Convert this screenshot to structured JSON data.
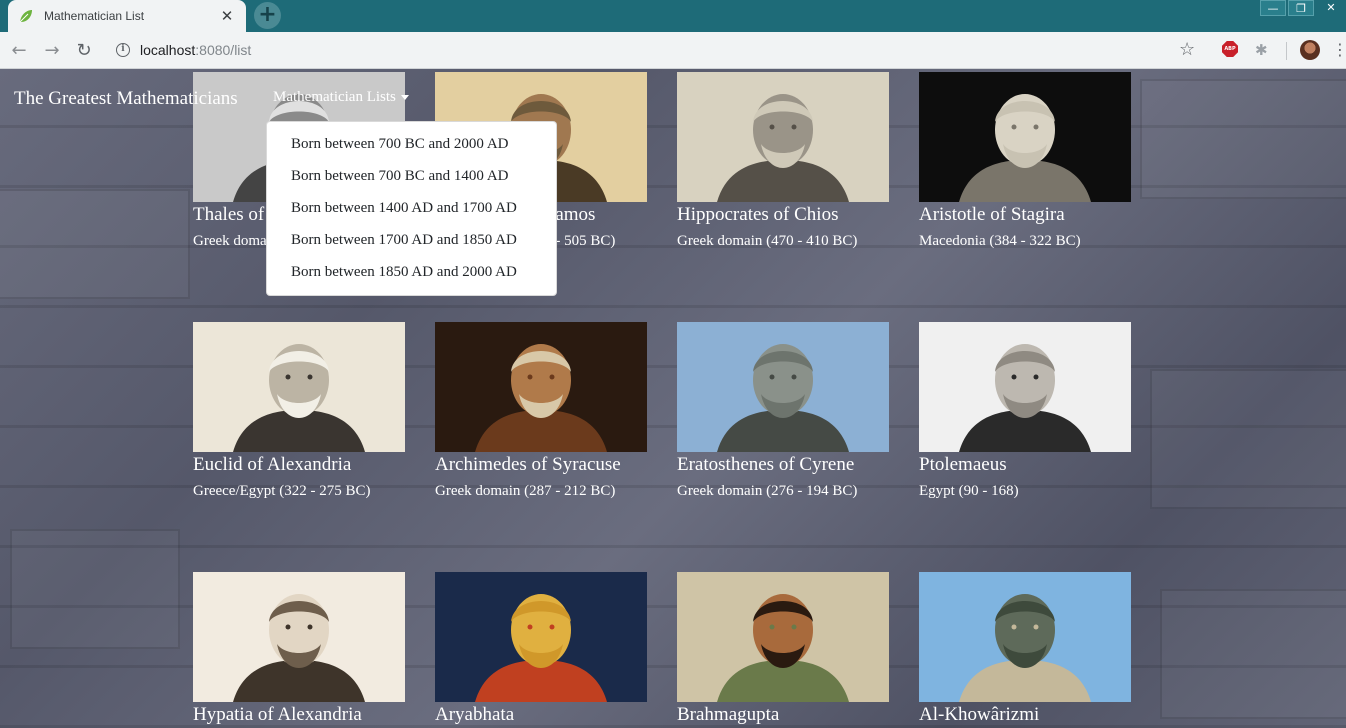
{
  "browser": {
    "tab_title": "Mathematician List",
    "tab_close": "✕",
    "new_tab": "+",
    "url_host": "localhost",
    "url_rest": ":8080/list",
    "nav": {
      "back": "←",
      "forward": "→",
      "reload": "↻"
    },
    "window_controls": {
      "minimize": "—",
      "maximize": "❐",
      "close": "✕"
    },
    "star": "☆",
    "abp": "ABP",
    "ext": "✱",
    "menu": "⋮",
    "info": "i"
  },
  "navbar": {
    "brand": "The Greatest Mathematicians",
    "dropdown_label": "Mathematician Lists"
  },
  "dropdown": {
    "items": [
      "Born between 700 BC and 2000 AD",
      "Born between 700 BC and 1400 AD",
      "Born between 1400 AD and 1700 AD",
      "Born between 1700 AD and 1850 AD",
      "Born between 1850 AD and 2000 AD"
    ]
  },
  "cards": [
    {
      "name": "Thales of Miletus",
      "info": "Greek domain (624 - 546 BC)",
      "palette": "bw"
    },
    {
      "name": "Pythagoras of Samos",
      "info": "Greek domain (570 - 505 BC)",
      "palette": "parchment"
    },
    {
      "name": "Hippocrates of Chios",
      "info": "Greek domain (470 - 410 BC)",
      "palette": "sepia"
    },
    {
      "name": "Aristotle of Stagira",
      "info": "Macedonia (384 - 322 BC)",
      "palette": "marble"
    },
    {
      "name": "Euclid of Alexandria",
      "info": "Greece/Egypt (322 - 275 BC)",
      "palette": "engraving"
    },
    {
      "name": "Archimedes of Syracuse",
      "info": "Greek domain (287 - 212 BC)",
      "palette": "painting"
    },
    {
      "name": "Eratosthenes of Cyrene",
      "info": "Greek domain (276 - 194 BC)",
      "palette": "statue"
    },
    {
      "name": "Ptolemaeus",
      "info": "Egypt (90 - 168)",
      "palette": "engraving2"
    },
    {
      "name": "Hypatia of Alexandria",
      "info": "",
      "palette": "sketch"
    },
    {
      "name": "Aryabhata",
      "info": "",
      "palette": "cosmic"
    },
    {
      "name": "Brahmagupta",
      "info": "",
      "palette": "illustration"
    },
    {
      "name": "Al-Khowârizmi",
      "info": "",
      "palette": "bronze"
    }
  ]
}
